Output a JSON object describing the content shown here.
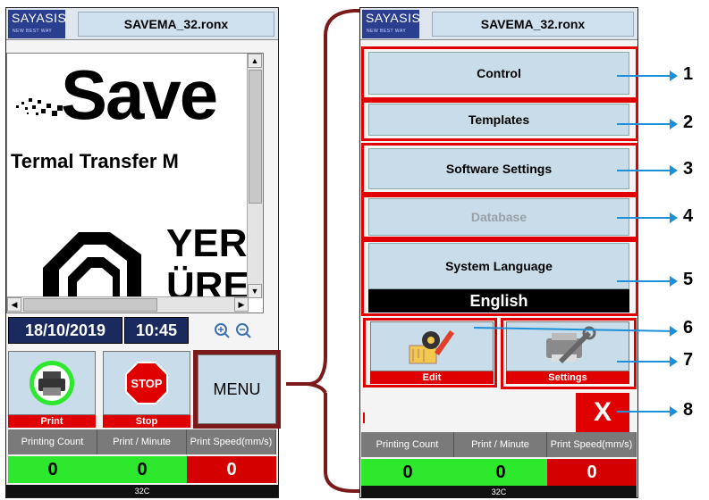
{
  "left_screen": {
    "logo": {
      "text": "SAYASIS",
      "tagline": "NEW BEST WAY"
    },
    "filename": "SAVEMA_32.ronx",
    "preview": {
      "brand": "Save",
      "subtitle": "Termal Transfer M",
      "graphic_text_1": "YER",
      "graphic_text_2": "ÜRE"
    },
    "date": "18/10/2019",
    "time": "10:45",
    "buttons": {
      "print": "Print",
      "stop_icon_text": "STOP",
      "stop": "Stop",
      "menu": "MENU"
    },
    "counters": [
      {
        "label": "Printing Count",
        "value": "0"
      },
      {
        "label": "Print / Minute",
        "value": "0"
      },
      {
        "label": "Print Speed(mm/s)",
        "value": "0"
      }
    ],
    "status": "32C"
  },
  "right_screen": {
    "logo": {
      "text": "SAYASIS",
      "tagline": "NEW BEST WAY"
    },
    "filename": "SAVEMA_32.ronx",
    "menu": {
      "control": "Control",
      "templates": "Templates",
      "software_settings": "Software Settings",
      "database": "Database",
      "system_language": "System Language",
      "language_value": "English",
      "edit": "Edit",
      "settings": "Settings",
      "close": "X"
    },
    "counters": [
      {
        "label": "Printing Count",
        "value": "0"
      },
      {
        "label": "Print / Minute",
        "value": "0"
      },
      {
        "label": "Print Speed(mm/s)",
        "value": "0"
      }
    ],
    "status": "32C"
  },
  "callouts": [
    "1",
    "2",
    "3",
    "4",
    "5",
    "6",
    "7",
    "8"
  ],
  "colors": {
    "highlight_red": "#e00000",
    "callout_blue": "#1e90d6",
    "bracket": "#7a1a1a",
    "button_blue": "#c9dce9",
    "green_counter": "#2ee82e",
    "red_counter": "#d40000",
    "datetime_bg": "#1b2a5e"
  }
}
